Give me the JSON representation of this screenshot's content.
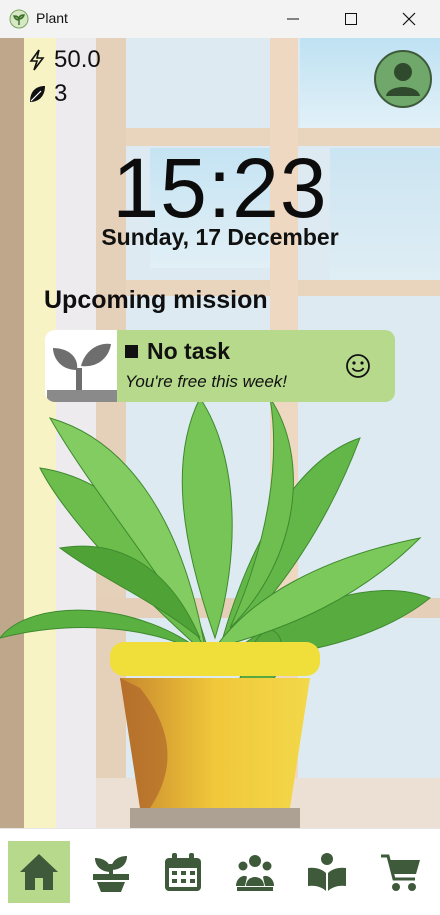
{
  "window": {
    "title": "Plant"
  },
  "stats": {
    "energy": "50.0",
    "leaves": "3"
  },
  "clock": {
    "time": "15:23",
    "date": "Sunday, 17 December"
  },
  "mission": {
    "heading": "Upcoming mission",
    "task_title": "No task",
    "task_subtitle": "You're free this week!"
  },
  "nav": {
    "items": [
      {
        "icon": "home-icon",
        "active": true
      },
      {
        "icon": "plant-pot-icon",
        "active": false
      },
      {
        "icon": "calendar-icon",
        "active": false
      },
      {
        "icon": "community-icon",
        "active": false
      },
      {
        "icon": "book-icon",
        "active": false
      },
      {
        "icon": "cart-icon",
        "active": false
      }
    ]
  },
  "colors": {
    "accent": "#b6d98c",
    "nav_icon": "#3e5a3b",
    "avatar": "#6fa86a"
  }
}
